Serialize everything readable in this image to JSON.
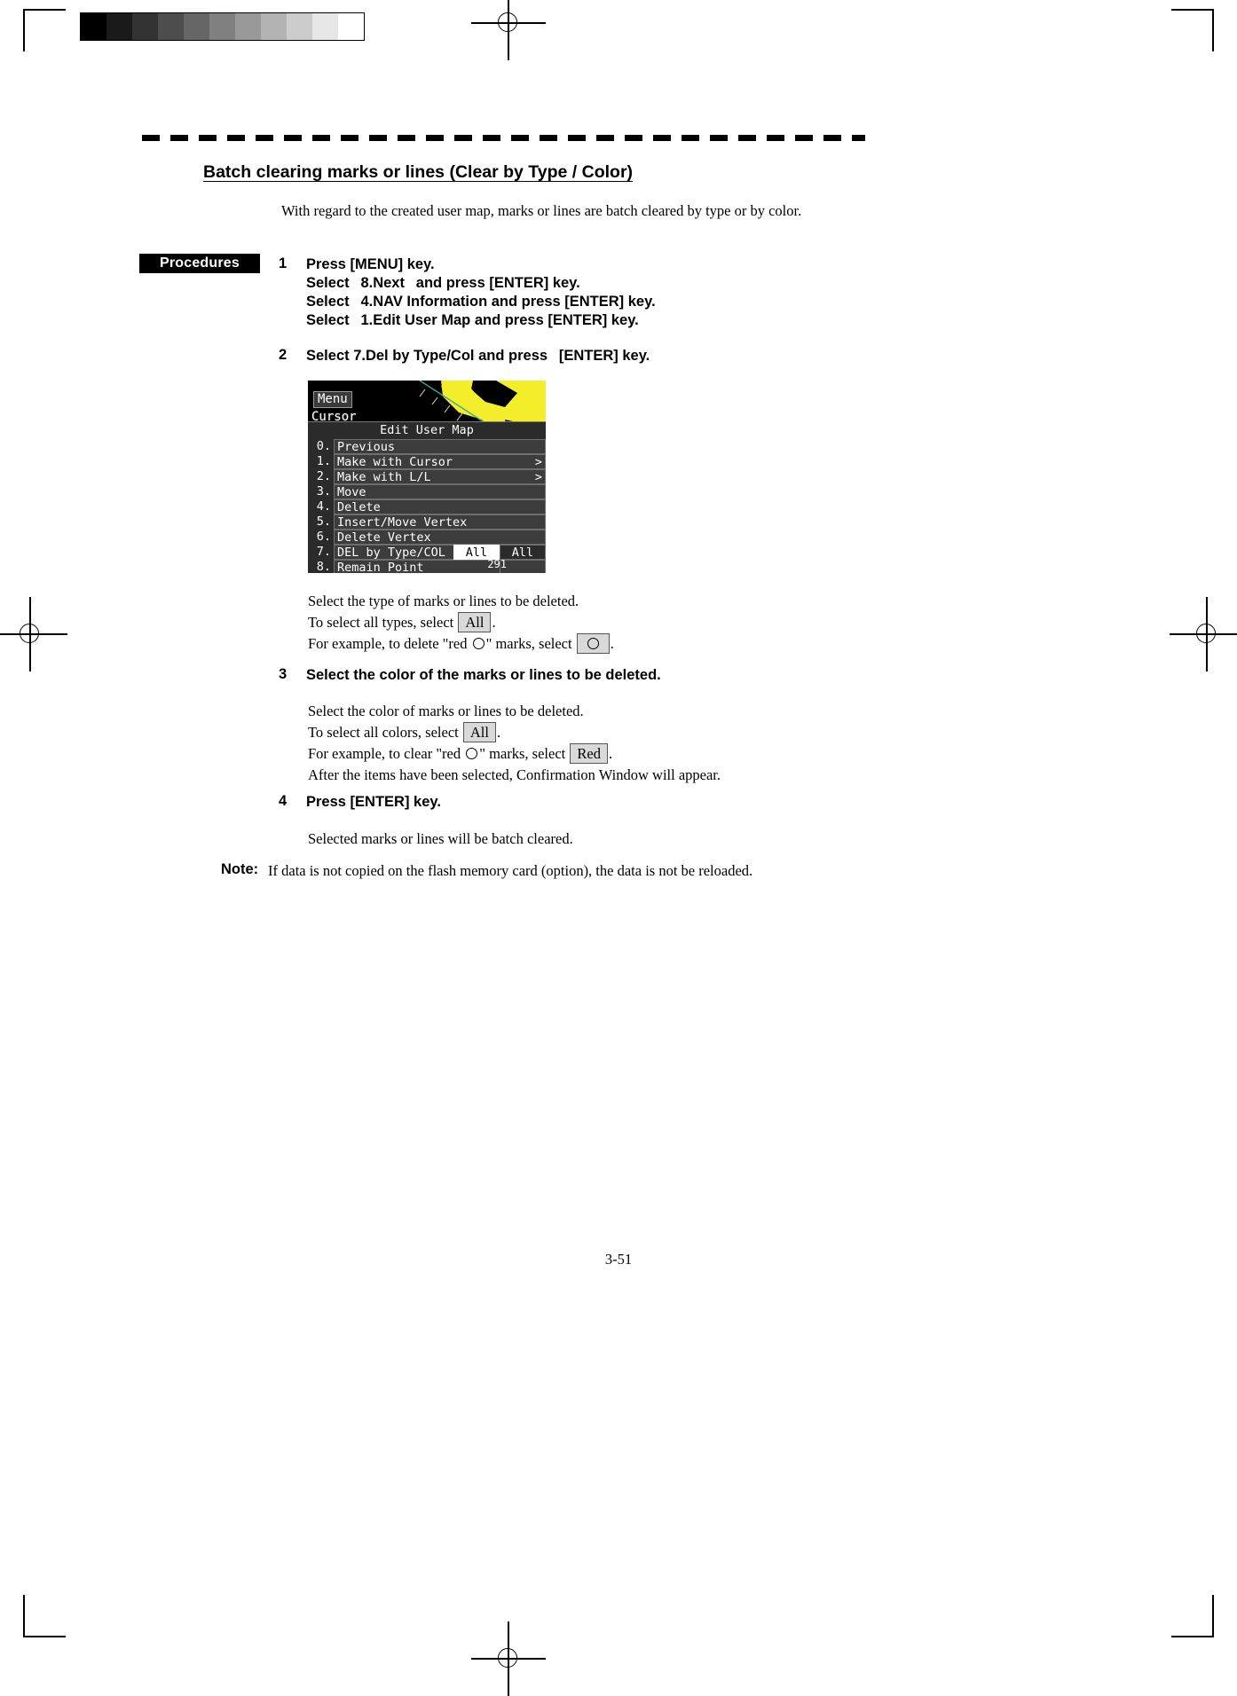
{
  "page": {
    "title": "Batch clearing marks or lines (Clear by Type / Color)",
    "intro": "With regard to the created user map, marks or lines are batch cleared by type or by color.",
    "number": "3-51"
  },
  "procedures": {
    "tag": "Procedures",
    "steps": [
      {
        "num": "1",
        "lines": [
          "Press [MENU] key.",
          "Select  8.Next  and press [ENTER] key.",
          "Select  4.NAV Information and press [ENTER] key.",
          "Select  1.Edit User Map and press [ENTER] key."
        ]
      },
      {
        "num": "2",
        "lines": [
          "Select 7.Del by Type/Col and press  [ENTER] key."
        ],
        "body": [
          "Select the type of marks or lines to be deleted.",
          "To select all types, select",
          "For example, to delete \"red",
          "\" marks, select"
        ],
        "keycap_all": "All"
      },
      {
        "num": "3",
        "lines": [
          "Select the color of the marks or lines to be deleted."
        ],
        "body": [
          "Select the color of marks or lines to be deleted.",
          "To select all colors, select",
          "For example, to clear \"red",
          "\" marks, select",
          "After the items have been selected, Confirmation Window will appear."
        ],
        "keycap_all": "All",
        "keycap_red": "Red"
      },
      {
        "num": "4",
        "lines": [
          "Press [ENTER] key."
        ],
        "body": [
          "Selected marks or lines will be batch cleared."
        ]
      }
    ]
  },
  "note": {
    "label": "Note:",
    "text": "If data is not copied on the flash memory card (option), the data is not be reloaded."
  },
  "device_screen": {
    "menu_button": "Menu",
    "cursor_label": "Cursor",
    "panel_title": "Edit User Map",
    "items": [
      {
        "idx": "0.",
        "label": "Previous",
        "arrow": "",
        "value": ""
      },
      {
        "idx": "1.",
        "label": "Make with Cursor",
        "arrow": ">",
        "value": ""
      },
      {
        "idx": "2.",
        "label": "Make with L/L",
        "arrow": ">",
        "value": ""
      },
      {
        "idx": "3.",
        "label": "Move",
        "arrow": "",
        "value": ""
      },
      {
        "idx": "4.",
        "label": "Delete",
        "arrow": "",
        "value": ""
      },
      {
        "idx": "5.",
        "label": "Insert/Move Vertex",
        "arrow": "",
        "value": ""
      },
      {
        "idx": "6.",
        "label": "Delete Vertex",
        "arrow": "",
        "value": ""
      },
      {
        "idx": "7.",
        "label": "DEL by Type/COL",
        "value_type": "All",
        "value_color": "All"
      },
      {
        "idx": "8.",
        "label": "Remain Point",
        "value": ""
      }
    ],
    "remain_point_value": "291",
    "colors": {
      "land": "#f3ed2a",
      "sea": "#000000",
      "panel": "#2b2b2b",
      "row": "#3c3c3c",
      "highlight": "#ffffff",
      "route": "#34a8a8"
    }
  },
  "greyscale_steps": [
    "#000000",
    "#1a1a1a",
    "#333333",
    "#4d4d4d",
    "#666666",
    "#808080",
    "#999999",
    "#b3b3b3",
    "#cccccc",
    "#e6e6e6",
    "#ffffff"
  ]
}
